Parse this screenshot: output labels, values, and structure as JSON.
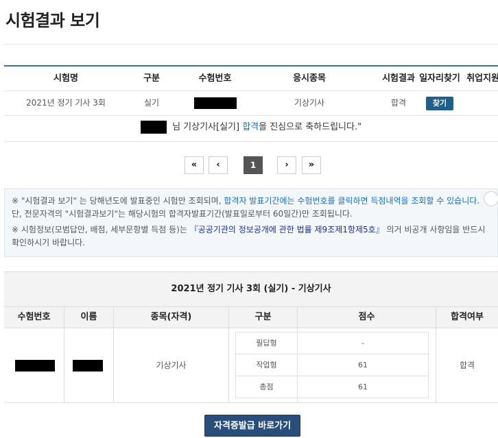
{
  "page": {
    "title": "시험결과 보기"
  },
  "results": {
    "headers": [
      "시험명",
      "구분",
      "수험번호",
      "응시종목",
      "시험결과",
      "일자리찾기",
      "취업지원"
    ],
    "row": {
      "exam_name": "2021년 정기 기사 3회",
      "type": "실기",
      "subject": "기상기사",
      "result": "합격",
      "find_button": "찾기"
    }
  },
  "congrats": {
    "prefix": " 님 기상기사[실기] ",
    "highlight": "합격",
    "suffix": "을 진심으로 축하드립니다.\""
  },
  "pager": {
    "first": "«",
    "prev": "‹",
    "current": "1",
    "next": "›",
    "last": "»"
  },
  "notice": {
    "line1_a": "※ \"시험결과 보기\" 는 당해년도에 발표중인 시험만 조회되며, ",
    "line1_b": "합격자 발표기간에는 수험번호를 클릭하면 득점내역을 조회할 수 있습니다.",
    "line1_c": " 단, 전문자격의 \"시험결과보기\"는 해당시험의 합격자발표기간(발표일로부터 60일간)만 조회됩니다.",
    "line2_a": "※ 시험정보(모범답안, 배점, 세부문항별 득점 등)는 ",
    "line2_b": "『공공기관의 정보공개에 관한 법률 제9조제1항제5호』",
    "line2_c": " 의거 비공개 사항임을 반드시 확인하시기 바랍니다."
  },
  "detail": {
    "title": "2021년 정기 기사 3회 (실기) - 기상기사",
    "headers": [
      "수험번호",
      "이름",
      "종목(자격)",
      "구분",
      "점수",
      "합격여부"
    ],
    "subject": "기상기사",
    "pass_status": "합격",
    "scores": [
      {
        "label": "필답형",
        "score": "-"
      },
      {
        "label": "작업형",
        "score": "61"
      },
      {
        "label": "총점",
        "score": "61"
      }
    ]
  },
  "cert_button": "자격증발급 바로가기",
  "colors": {
    "accent": "#3a6f9c",
    "button": "#1f5f8e",
    "highlight": "#1a6ec0",
    "cert_button": "#2a4e7a"
  }
}
